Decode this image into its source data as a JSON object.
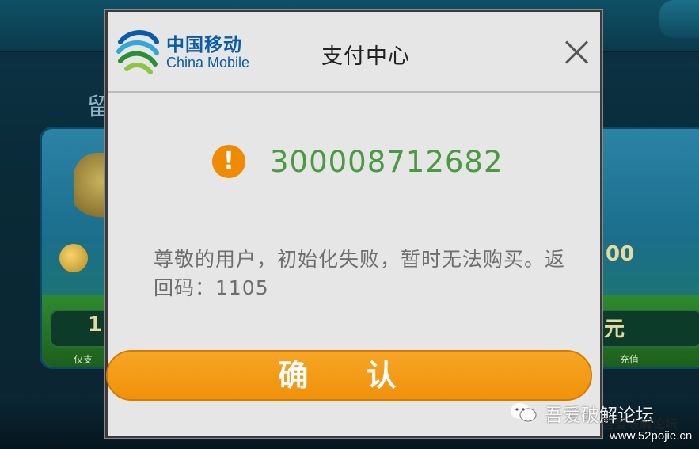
{
  "dialog": {
    "brand_cn": "中国移动",
    "brand_en": "China Mobile",
    "title": "支付中心",
    "error_code": "300008712682",
    "message": "尊敬的用户，初始化失败，暂时无法购买。返回码：1105",
    "confirm_label": "确 认",
    "close_icon": "close-icon",
    "warning_icon": "exclamation-circle-icon"
  },
  "background": {
    "left_digit": "1",
    "left_label": "仅支",
    "right_digits": "00",
    "right_char": "元",
    "right_label": "充值",
    "side_char": "留"
  },
  "watermark": {
    "text": "吾爱破解论坛",
    "shadow_text": "吾爱破解论坛",
    "url": "www.52pojie.cn"
  },
  "colors": {
    "accent_orange": "#f0920a",
    "code_green": "#4b9a41",
    "brand_blue": "#0a5ca8"
  }
}
